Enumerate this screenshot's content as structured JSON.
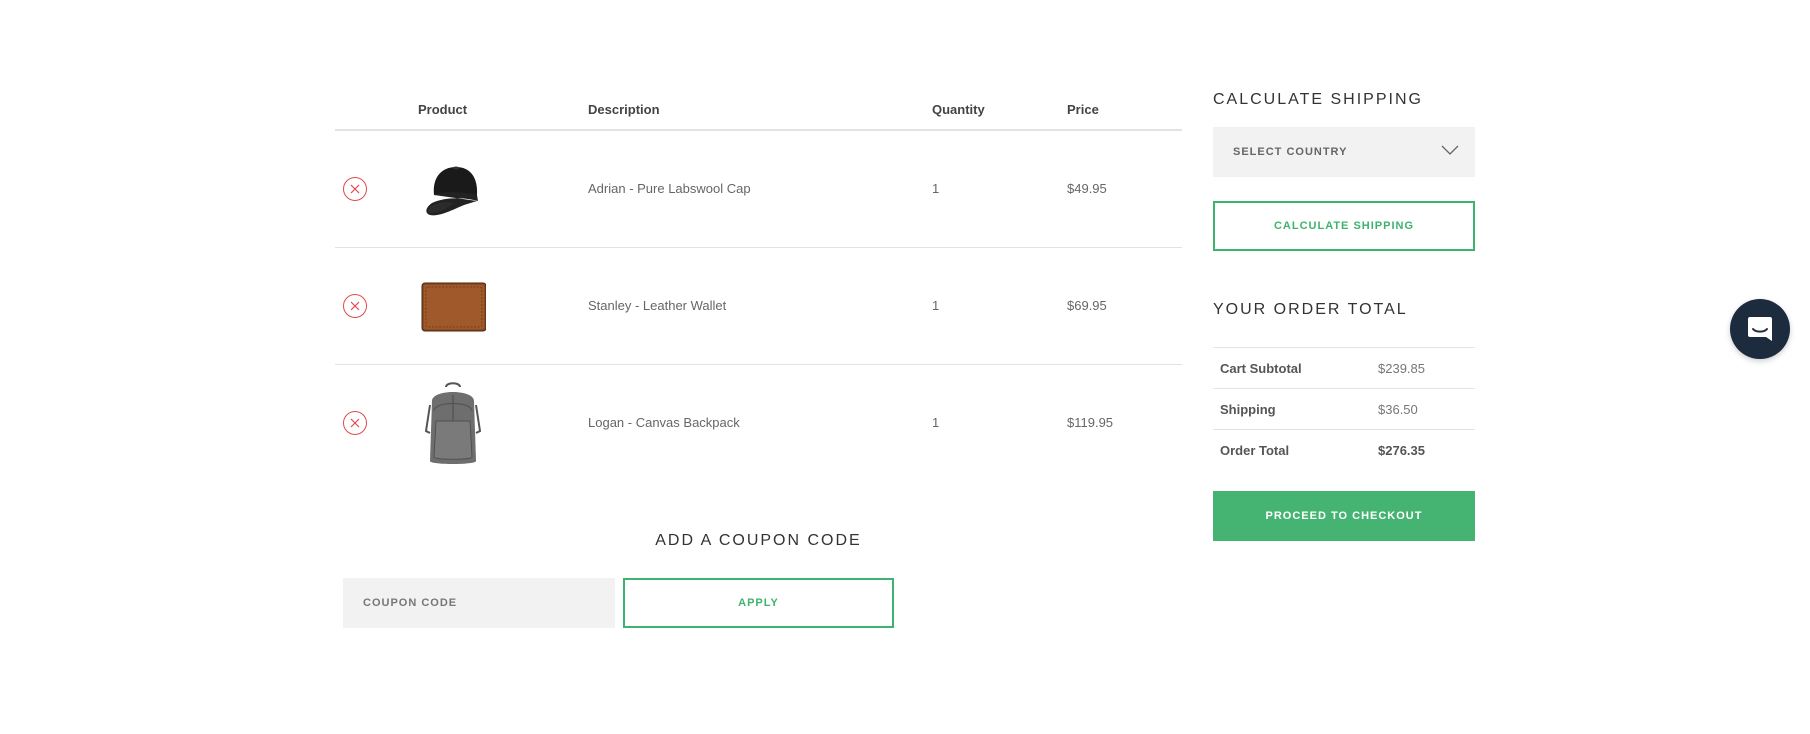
{
  "cart": {
    "headers": {
      "product": "Product",
      "description": "Description",
      "quantity": "Quantity",
      "price": "Price"
    },
    "items": [
      {
        "description": "Adrian - Pure Labswool Cap",
        "quantity": "1",
        "price": "$49.95",
        "image": "black-cap-image"
      },
      {
        "description": "Stanley - Leather Wallet",
        "quantity": "1",
        "price": "$69.95",
        "image": "brown-wallet-image"
      },
      {
        "description": "Logan - Canvas Backpack",
        "quantity": "1",
        "price": "$119.95",
        "image": "grey-backpack-image"
      }
    ]
  },
  "coupon": {
    "title": "ADD A COUPON CODE",
    "placeholder": "COUPON CODE",
    "apply_label": "APPLY"
  },
  "shipping": {
    "title": "CALCULATE SHIPPING",
    "country_label": "SELECT COUNTRY",
    "calculate_label": "CALCULATE SHIPPING"
  },
  "order": {
    "title": "YOUR ORDER TOTAL",
    "rows": [
      {
        "label": "Cart Subtotal",
        "value": "$239.85"
      },
      {
        "label": "Shipping",
        "value": "$36.50"
      },
      {
        "label": "Order Total",
        "value": "$276.35"
      }
    ],
    "checkout_label": "PROCEED TO CHECKOUT"
  },
  "colors": {
    "accent": "#3db36e",
    "remove": "#e04a4a",
    "chat": "#1c2b3d"
  }
}
